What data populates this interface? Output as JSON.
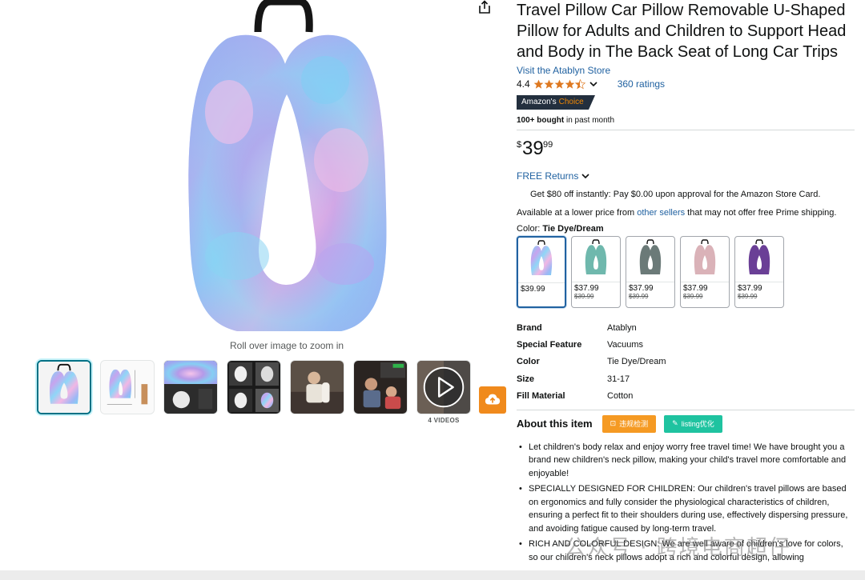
{
  "gallery": {
    "zoom_hint": "Roll over image to zoom in",
    "videos_label": "4 VIDEOS",
    "thumbnails": [
      "product-front",
      "product-dimensions",
      "product-closeup",
      "product-car-seats",
      "person-in-car",
      "child-sleeping-in-car",
      "video"
    ],
    "icons": {
      "share": "share-icon",
      "upload": "cloud-upload-icon",
      "play": "play-icon"
    }
  },
  "product": {
    "title": "Travel Pillow Car Pillow Removable U-Shaped Pillow for Adults and Children to Support Head and Body in The Back Seat of Long Car Trips",
    "store_link": "Visit the Atablyn Store",
    "rating": "4.4",
    "rating_stars": 4.4,
    "ratings_count": "360 ratings",
    "badge_prefix": "Amazon's",
    "badge_choice": "Choice",
    "bought_bold": "100+ bought",
    "bought_rest": " in past month",
    "price_symbol": "$",
    "price_whole": "39",
    "price_fraction": "99",
    "returns": "FREE Returns",
    "card_offer": "Get $80 off instantly: Pay $0.00 upon approval for the Amazon Store Card.",
    "lower_price_pre": "Available at a lower price from ",
    "lower_price_link": "other sellers",
    "lower_price_post": " that may not offer free Prime shipping.",
    "color_label": "Color: ",
    "color_selected": "Tie Dye/Dream"
  },
  "swatches": [
    {
      "price": "$39.99",
      "old_price": "",
      "color": "tie-dye",
      "selected": true
    },
    {
      "price": "$37.99",
      "old_price": "$39.99",
      "color": "#6fb8ad"
    },
    {
      "price": "$37.99",
      "old_price": "$39.99",
      "color": "#6b7a78"
    },
    {
      "price": "$37.99",
      "old_price": "$39.99",
      "color": "#dab2b8"
    },
    {
      "price": "$37.99",
      "old_price": "$39.99",
      "color": "#6a3f96"
    }
  ],
  "specs": [
    {
      "key": "Brand",
      "value": "Atablyn"
    },
    {
      "key": "Special Feature",
      "value": "Vacuums"
    },
    {
      "key": "Color",
      "value": "Tie Dye/Dream"
    },
    {
      "key": "Size",
      "value": "31-17"
    },
    {
      "key": "Fill Material",
      "value": "Cotton"
    }
  ],
  "about": {
    "title": "About this item",
    "btn_violation": "违规检测",
    "btn_listing": "listing优化",
    "bullets": [
      "Let children's body relax and enjoy worry free travel time! We have brought you a brand new children's neck pillow, making your child's travel more comfortable and enjoyable!",
      "SPECIALLY DESIGNED FOR CHILDREN: Our children's travel pillows are based on ergonomics and fully consider the physiological characteristics of children, ensuring a perfect fit to their shoulders during use, effectively dispersing pressure, and avoiding fatigue caused by long-term travel.",
      "RICH AND COLORFUL DESIGN: We are well aware of children's love for colors, so our children's neck pillows adopt a rich and colorful design, allowing"
    ]
  },
  "watermark": "公众号 · 跨境电商超仔",
  "colors": {
    "link": "#2162a1",
    "selected_border": "#007185",
    "badge_bg": "#232f3e",
    "badge_accent": "#f08804",
    "star": "#de7921",
    "violation_btn": "#f59a23",
    "listing_btn": "#1fc3a0"
  }
}
